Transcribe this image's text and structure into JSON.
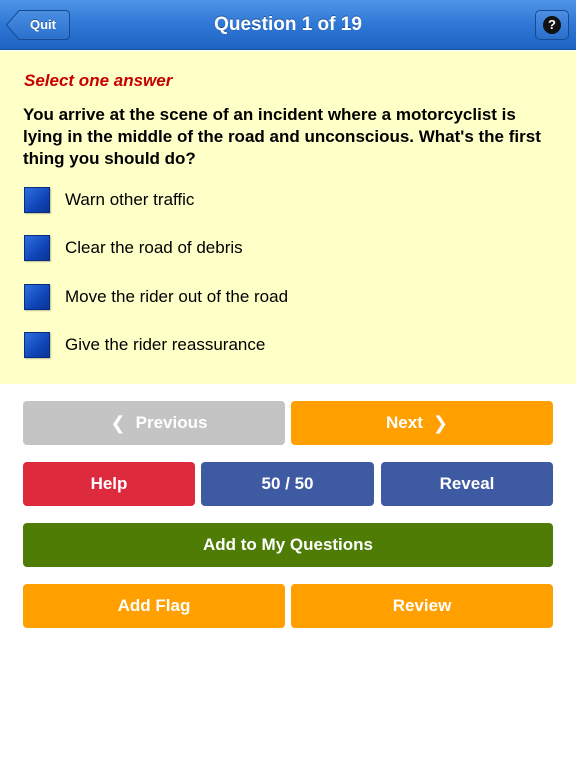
{
  "navbar": {
    "title": "Question 1 of 19",
    "quit_label": "Quit",
    "help_glyph": "?"
  },
  "question": {
    "instruction": "Select one answer",
    "text": "You arrive at the scene of an incident where a motorcyclist is lying in the middle of the road and unconscious. What's the first thing you should do?",
    "answers": [
      {
        "label": "Warn other traffic"
      },
      {
        "label": "Clear the road of debris"
      },
      {
        "label": "Move the rider out of the road"
      },
      {
        "label": "Give the rider reassurance"
      }
    ]
  },
  "buttons": {
    "previous": "Previous",
    "next": "Next",
    "help": "Help",
    "fifty_fifty": "50 / 50",
    "reveal": "Reveal",
    "add_to_my_questions": "Add to My Questions",
    "add_flag": "Add Flag",
    "review": "Review"
  },
  "colors": {
    "navbar": "#2f77d6",
    "panel": "#ffffc8",
    "instruction": "#c80000",
    "checkbox": "#1a55c8",
    "gray": "#c4c4c4",
    "orange": "#ffa000",
    "red": "#dd2a3d",
    "blue": "#3e5aa3",
    "green": "#4f7c05"
  },
  "icons": {
    "previous": "chevron-left-icon",
    "next": "chevron-right-icon",
    "help": "question-mark-icon"
  }
}
